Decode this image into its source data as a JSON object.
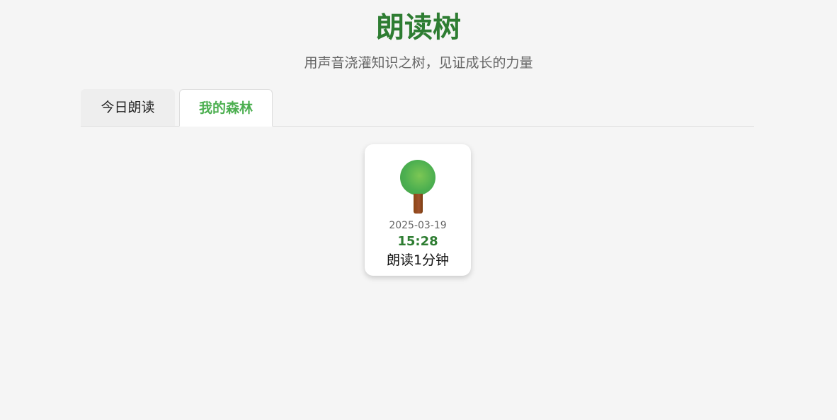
{
  "header": {
    "title": "朗读树",
    "subtitle": "用声音浇灌知识之树，见证成长的力量"
  },
  "tabs": [
    {
      "label": "今日朗读",
      "active": false
    },
    {
      "label": "我的森林",
      "active": true
    }
  ],
  "forest": {
    "trees": [
      {
        "date": "2025-03-19",
        "time": "15:28",
        "duration": "朗读1分钟",
        "icon": "tree-icon"
      }
    ]
  },
  "colors": {
    "brand_green": "#2e7d32",
    "active_tab": "#4caf50",
    "background": "#f5f5f5",
    "trunk": "#8b4513"
  }
}
